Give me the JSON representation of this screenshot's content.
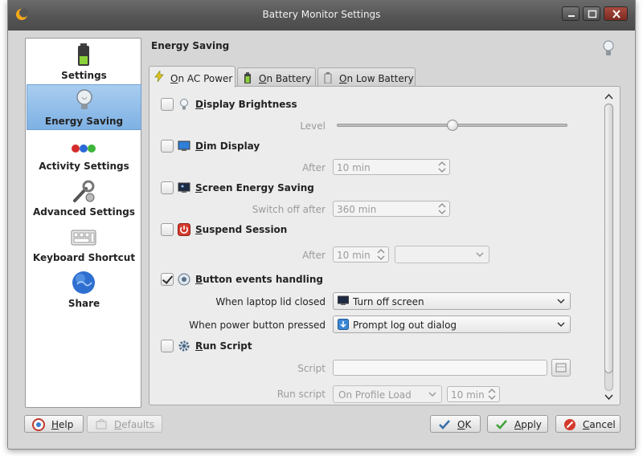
{
  "window": {
    "title": "Battery Monitor Settings"
  },
  "sidebar": {
    "items": [
      {
        "label": "Settings"
      },
      {
        "label": "Energy Saving"
      },
      {
        "label": "Activity Settings"
      },
      {
        "label": "Advanced Settings"
      },
      {
        "label": "Keyboard Shortcut"
      },
      {
        "label": "Share"
      }
    ]
  },
  "page": {
    "title": "Energy Saving"
  },
  "tabs": [
    {
      "pre": "",
      "u": "O",
      "post": "n AC Power"
    },
    {
      "pre": "",
      "u": "O",
      "post": "n Battery"
    },
    {
      "pre": "",
      "u": "O",
      "post": "n Low Battery"
    }
  ],
  "sections": {
    "display_brightness": {
      "u": "D",
      "rest": "isplay Brightness",
      "checked": false,
      "level_label": "Level",
      "level": 0.5
    },
    "dim_display": {
      "u": "D",
      "rest": "im Display",
      "checked": false,
      "after_label": "After",
      "after_value": "10 min"
    },
    "screen_energy": {
      "u": "S",
      "rest": "creen Energy Saving",
      "checked": false,
      "switch_label": "Switch off after",
      "switch_value": "360 min"
    },
    "suspend": {
      "u": "S",
      "rest": "uspend Session",
      "checked": false,
      "after_label": "After",
      "after_value": "10 min",
      "method_value": ""
    },
    "button_events": {
      "u": "B",
      "rest": "utton events handling",
      "checked": true,
      "lid_label": "When laptop lid closed",
      "lid_value": "Turn off screen",
      "power_label": "When power button pressed",
      "power_value": "Prompt log out dialog"
    },
    "run_script": {
      "u": "R",
      "rest": "un Script",
      "checked": false,
      "script_label": "Script",
      "script_value": "",
      "run_label": "Run script",
      "run_value": "On Profile Load",
      "run_time": "10 min"
    }
  },
  "buttons": {
    "help": {
      "u": "H",
      "rest": "elp"
    },
    "defaults": {
      "u": "D",
      "rest": "efaults"
    },
    "ok": {
      "u": "O",
      "rest": "K"
    },
    "apply": {
      "u": "A",
      "rest": "pply"
    },
    "cancel": {
      "u": "C",
      "rest": "ancel"
    }
  },
  "colors": {
    "selection": "#7eb1e4",
    "titlebar": "#555555",
    "close": "#8b332a"
  }
}
